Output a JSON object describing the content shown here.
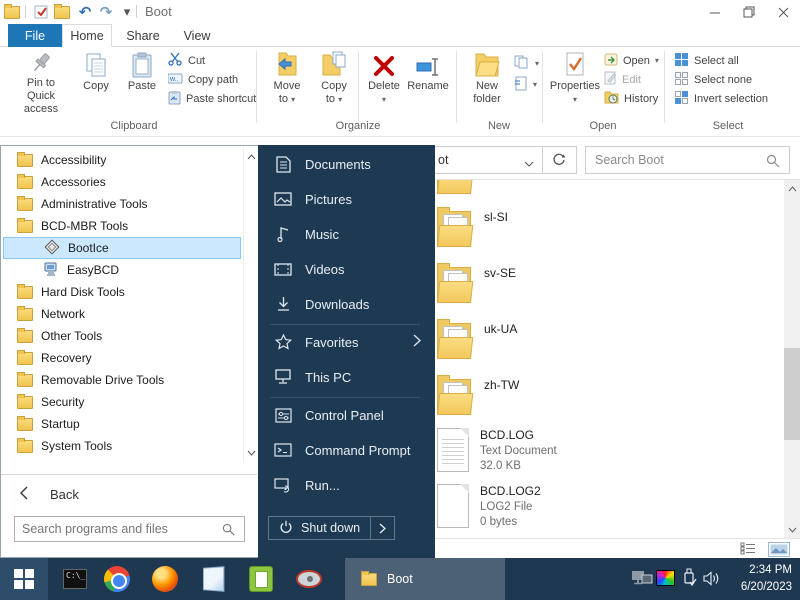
{
  "window": {
    "title": "Boot"
  },
  "icons": {
    "dropdown": "▾",
    "undo": "↶",
    "redo": "↷"
  },
  "ribbon": {
    "tabs": [
      {
        "label": "File"
      },
      {
        "label": "Home"
      },
      {
        "label": "Share"
      },
      {
        "label": "View"
      }
    ],
    "groups": {
      "clipboard": {
        "label": "Clipboard",
        "pin_line1": "Pin to Quick",
        "pin_line2": "access",
        "copy": "Copy",
        "paste": "Paste",
        "cut": "Cut",
        "copy_path": "Copy path",
        "paste_shortcut": "Paste shortcut"
      },
      "organize": {
        "label": "Organize",
        "move_line1": "Move",
        "move_line2": "to",
        "copy_line1": "Copy",
        "copy_line2": "to",
        "delete": "Delete",
        "rename": "Rename"
      },
      "new_group": {
        "label": "New",
        "new_line1": "New",
        "new_line2": "folder"
      },
      "open_group": {
        "label": "Open",
        "properties": "Properties",
        "open": "Open",
        "edit": "Edit",
        "history": "History"
      },
      "select_group": {
        "label": "Select",
        "select_all": "Select all",
        "select_none": "Select none",
        "invert": "Invert selection"
      }
    }
  },
  "address_bar": {
    "path_fragment": "ot",
    "search_placeholder": "Search Boot"
  },
  "file_list": {
    "items": [
      {
        "name": "sl-SI",
        "kind": "folder"
      },
      {
        "name": "sv-SE",
        "kind": "folder"
      },
      {
        "name": "uk-UA",
        "kind": "folder"
      },
      {
        "name": "zh-TW",
        "kind": "folder"
      },
      {
        "name": "BCD.LOG",
        "type": "Text Document",
        "size": "32.0 KB",
        "kind": "text-file"
      },
      {
        "name": "BCD.LOG2",
        "type": "LOG2 File",
        "size": "0 bytes",
        "kind": "blank-file"
      }
    ]
  },
  "start_menu": {
    "programs": [
      {
        "label": "Accessibility",
        "kind": "folder"
      },
      {
        "label": "Accessories",
        "kind": "folder"
      },
      {
        "label": "Administrative Tools",
        "kind": "folder"
      },
      {
        "label": "BCD-MBR Tools",
        "kind": "folder"
      },
      {
        "label": "BootIce",
        "kind": "app",
        "selected": true
      },
      {
        "label": "EasyBCD",
        "kind": "app"
      },
      {
        "label": "Hard Disk Tools",
        "kind": "folder"
      },
      {
        "label": "Network",
        "kind": "folder"
      },
      {
        "label": "Other Tools",
        "kind": "folder"
      },
      {
        "label": "Recovery",
        "kind": "folder"
      },
      {
        "label": "Removable Drive Tools",
        "kind": "folder"
      },
      {
        "label": "Security",
        "kind": "folder"
      },
      {
        "label": "Startup",
        "kind": "folder"
      },
      {
        "label": "System Tools",
        "kind": "folder"
      }
    ],
    "back_label": "Back",
    "search_placeholder": "Search programs and files",
    "places": [
      {
        "label": "Documents",
        "icon": "document-icon"
      },
      {
        "label": "Pictures",
        "icon": "picture-icon"
      },
      {
        "label": "Music",
        "icon": "music-icon"
      },
      {
        "label": "Videos",
        "icon": "video-icon"
      },
      {
        "label": "Downloads",
        "icon": "download-icon"
      },
      {
        "label": "Favorites",
        "icon": "star-icon",
        "has_submenu": true
      },
      {
        "label": "This PC",
        "icon": "computer-icon"
      },
      {
        "label": "Control Panel",
        "icon": "control-panel-icon"
      },
      {
        "label": "Command Prompt",
        "icon": "command-prompt-icon"
      },
      {
        "label": "Run...",
        "icon": "run-icon"
      }
    ],
    "shutdown_label": "Shut down"
  },
  "taskbar": {
    "app_icons": [
      "command-prompt",
      "chrome",
      "firefox",
      "notepad",
      "notepad-plus-plus",
      "disk-partition-tool"
    ],
    "active_window": "Boot",
    "tray_icons": [
      "network",
      "display-color",
      "usb-eject",
      "volume"
    ],
    "clock_time": "2:34 PM",
    "clock_date": "6/20/2023"
  },
  "colors": {
    "accent_blue": "#1d77b7",
    "menu_dark": "#1e3a53",
    "selection": "#cce8ff",
    "folder_yellow": "#f0c44f"
  }
}
